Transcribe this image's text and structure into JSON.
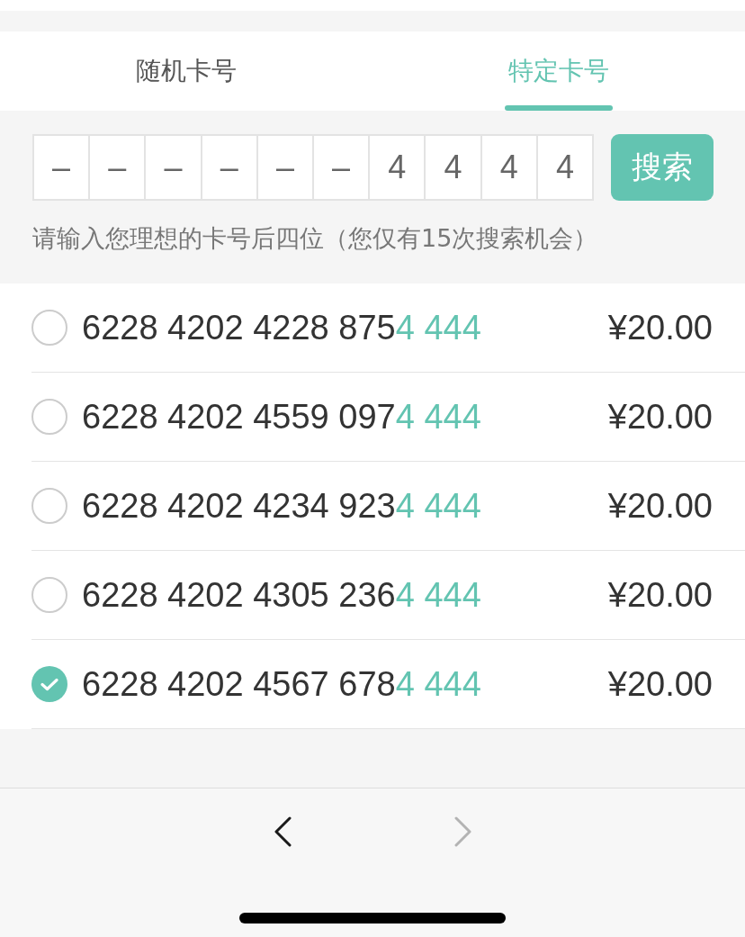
{
  "tabs": [
    {
      "label": "随机卡号",
      "selected": false
    },
    {
      "label": "特定卡号",
      "selected": true
    }
  ],
  "search": {
    "digits": [
      "–",
      "–",
      "–",
      "–",
      "–",
      "–",
      "4",
      "4",
      "4",
      "4"
    ],
    "button": "搜索",
    "hint": "请输入您理想的卡号后四位（您仅有15次搜索机会）"
  },
  "cards": [
    {
      "number": "6228 4202 4228 875",
      "match": "4 444",
      "price": "¥20.00",
      "selected": false
    },
    {
      "number": "6228 4202 4559 097",
      "match": "4 444",
      "price": "¥20.00",
      "selected": false
    },
    {
      "number": "6228 4202 4234 923",
      "match": "4 444",
      "price": "¥20.00",
      "selected": false
    },
    {
      "number": "6228 4202 4305 236",
      "match": "4 444",
      "price": "¥20.00",
      "selected": false
    },
    {
      "number": "6228 4202 4567 678",
      "match": "4 444",
      "price": "¥20.00",
      "selected": true
    }
  ],
  "nav": [
    {
      "kind": "back",
      "disabled": false
    },
    {
      "kind": "forward",
      "disabled": true
    }
  ]
}
